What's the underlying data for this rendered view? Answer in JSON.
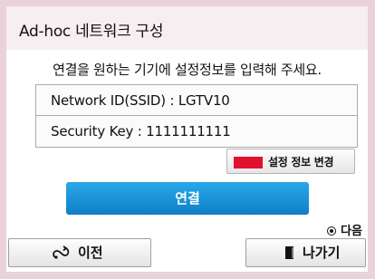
{
  "dialog": {
    "title": "Ad-hoc 네트워크 구성",
    "instruction": "연결을 원하는 기기에 설정정보를 입력해 주세요."
  },
  "info": {
    "network_id": "Network ID(SSID) : LGTV10",
    "security_key": "Security Key : 1111111111"
  },
  "buttons": {
    "change_settings": "설정 정보 변경",
    "connect": "연결",
    "prev": "이전",
    "exit": "나가기"
  },
  "hint": {
    "next": "다음"
  },
  "colors": {
    "accent_blue": "#1a93db",
    "red_key": "#e0102f",
    "background": "#e9d2dc"
  },
  "icons": {
    "change_settings": "red-key-icon",
    "next": "radio-button-icon",
    "prev": "back-arrow-icon",
    "exit": "exit-door-icon"
  }
}
